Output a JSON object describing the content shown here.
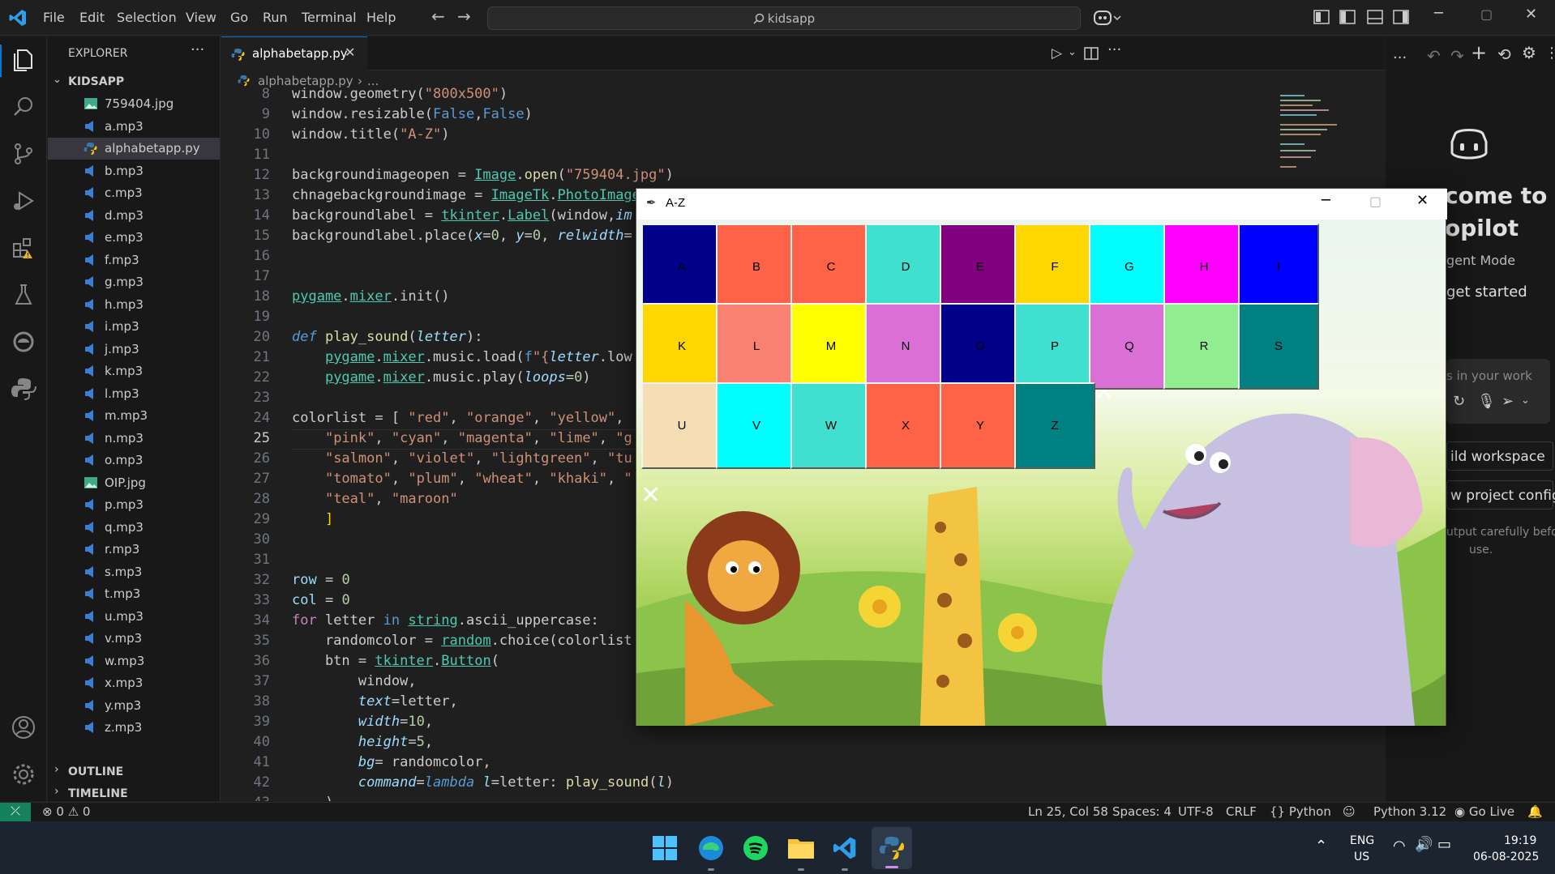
{
  "menu": [
    "File",
    "Edit",
    "Selection",
    "View",
    "Go",
    "Run",
    "Terminal",
    "Help"
  ],
  "search": {
    "text": "kidsapp"
  },
  "explorer": {
    "title": "EXPLORER",
    "folder": "KIDSAPP",
    "files": [
      "759404.jpg",
      "a.mp3",
      "alphabetapp.py",
      "b.mp3",
      "c.mp3",
      "d.mp3",
      "e.mp3",
      "f.mp3",
      "g.mp3",
      "h.mp3",
      "i.mp3",
      "j.mp3",
      "k.mp3",
      "l.mp3",
      "m.mp3",
      "n.mp3",
      "o.mp3",
      "OIP.jpg",
      "p.mp3",
      "q.mp3",
      "r.mp3",
      "s.mp3",
      "t.mp3",
      "u.mp3",
      "v.mp3",
      "w.mp3",
      "x.mp3",
      "y.mp3",
      "z.mp3"
    ],
    "outline": "OUTLINE",
    "timeline": "TIMELINE"
  },
  "editor": {
    "tab": "alphabetapp.py",
    "breadcrumb_file": "alphabetapp.py",
    "breadcrumb_more": "...",
    "lines": [
      "8",
      "9",
      "10",
      "11",
      "12",
      "13",
      "14",
      "15",
      "16",
      "17",
      "18",
      "19",
      "20",
      "21",
      "22",
      "23",
      "24",
      "25",
      "26",
      "27",
      "28",
      "29",
      "30",
      "31",
      "32",
      "33",
      "34",
      "35",
      "36",
      "37",
      "38",
      "39",
      "40",
      "41",
      "42",
      "43"
    ]
  },
  "copilot": {
    "welcome_1": "come to",
    "welcome_2": "opilot",
    "mode": "gent Mode",
    "get_started": "get started",
    "input_hint": "s in your work",
    "build": "ild workspace",
    "config": "w project config",
    "footer_1": "utput carefully before",
    "footer_2": "use."
  },
  "status": {
    "errors": "0",
    "warnings": "0",
    "position": "Ln 25, Col 58",
    "spaces": "Spaces: 4",
    "encoding": "UTF-8",
    "eol": "CRLF",
    "language": "Python",
    "interpreter": "Python 3.12",
    "golive": "Go Live"
  },
  "taskbar": {
    "lang_1": "ENG",
    "lang_2": "US",
    "time": "19:19",
    "date": "06-08-2025"
  },
  "tk": {
    "title": "A-Z",
    "buttons": [
      {
        "letter": "A",
        "color": "#00008b"
      },
      {
        "letter": "B",
        "color": "#ff6347"
      },
      {
        "letter": "C",
        "color": "#ff6347"
      },
      {
        "letter": "D",
        "color": "#40e0d0"
      },
      {
        "letter": "E",
        "color": "#800080"
      },
      {
        "letter": "F",
        "color": "#ffd700"
      },
      {
        "letter": "G",
        "color": "#00ffff"
      },
      {
        "letter": "H",
        "color": "#ff00ff"
      },
      {
        "letter": "I",
        "color": "#0000ff"
      },
      {
        "letter": "K",
        "color": "#ffd700"
      },
      {
        "letter": "L",
        "color": "#fa8072"
      },
      {
        "letter": "M",
        "color": "#ffff00"
      },
      {
        "letter": "N",
        "color": "#da70d6"
      },
      {
        "letter": "O",
        "color": "#00008b"
      },
      {
        "letter": "P",
        "color": "#40e0d0"
      },
      {
        "letter": "Q",
        "color": "#da70d6"
      },
      {
        "letter": "R",
        "color": "#90ee90"
      },
      {
        "letter": "S",
        "color": "#008080"
      },
      {
        "letter": "U",
        "color": "#f5deb3"
      },
      {
        "letter": "V",
        "color": "#00ffff"
      },
      {
        "letter": "W",
        "color": "#40e0d0"
      },
      {
        "letter": "X",
        "color": "#ff6347"
      },
      {
        "letter": "Y",
        "color": "#ff6347"
      },
      {
        "letter": "Z",
        "color": "#008080"
      }
    ]
  },
  "colors": {
    "accent": "#0078d4",
    "statusbar": "#181818"
  }
}
